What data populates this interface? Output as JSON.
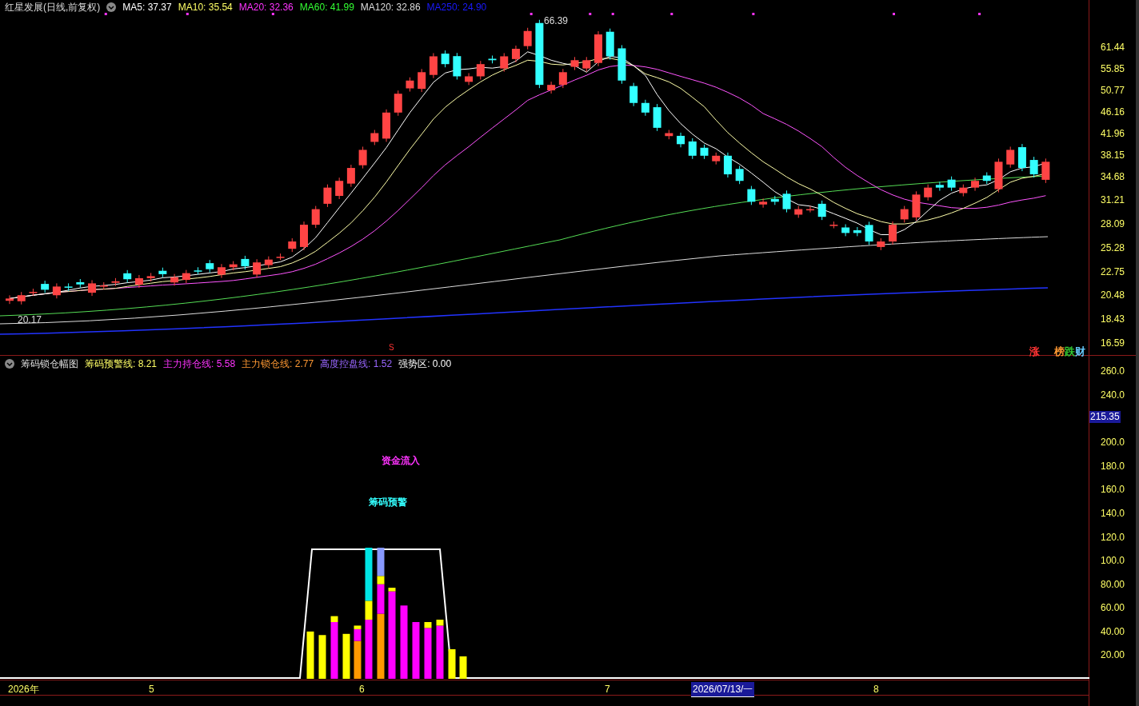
{
  "main_chart": {
    "title": "红星发展(日线,前复权)",
    "moving_averages": [
      {
        "label": "MA5: 37.37",
        "color": "#ffffff"
      },
      {
        "label": "MA10: 35.54",
        "color": "#ffff66"
      },
      {
        "label": "MA20: 32.36",
        "color": "#ff33ff"
      },
      {
        "label": "MA60: 41.99",
        "color": "#33ff33"
      },
      {
        "label": "MA120: 32.86",
        "color": "#dddddd"
      },
      {
        "label": "MA250: 24.90",
        "color": "#1a1aff"
      }
    ],
    "high_label": "66.39",
    "low_label": "20.17",
    "signal_mark": "S",
    "badges": [
      {
        "label": "涨",
        "color": "#ff3333"
      },
      {
        "label": "榜",
        "color": "#ff9933"
      },
      {
        "label": "跌",
        "color": "#33cc33"
      },
      {
        "label": "财",
        "color": "#66ccff"
      }
    ],
    "axis_labels": [
      "61.44",
      "55.85",
      "50.77",
      "46.16",
      "41.96",
      "38.15",
      "34.68",
      "31.21",
      "28.09",
      "25.28",
      "22.75",
      "20.48",
      "18.43",
      "16.59"
    ]
  },
  "indicator": {
    "title": "筹码锁仓幅图",
    "lines": [
      {
        "label": "筹码预警线: 8.21",
        "color": "#ffff66"
      },
      {
        "label": "主力持仓线: 5.58",
        "color": "#ff33ff"
      },
      {
        "label": "主力锁仓线: 2.77",
        "color": "#ff9933"
      },
      {
        "label": "高度控盘线: 1.52",
        "color": "#9966ff"
      },
      {
        "label": "强势区: 0.00",
        "color": "#ffffff"
      }
    ],
    "annotations": [
      {
        "text": "资金流入",
        "color": "#ff33ff"
      },
      {
        "text": "筹码预警",
        "color": "#33ffff"
      }
    ],
    "current_value": "215.35",
    "axis_labels": [
      "260.0",
      "240.0",
      "200.0",
      "180.0",
      "160.0",
      "140.0",
      "120.0",
      "100.0",
      "80.00",
      "60.00",
      "40.00",
      "20.00"
    ]
  },
  "time_axis": [
    {
      "label": "2026年",
      "selected": false
    },
    {
      "label": "5",
      "selected": false
    },
    {
      "label": "6",
      "selected": false
    },
    {
      "label": "7",
      "selected": false
    },
    {
      "label": "2026/07/13/一",
      "selected": true
    },
    {
      "label": "8",
      "selected": false
    }
  ]
}
